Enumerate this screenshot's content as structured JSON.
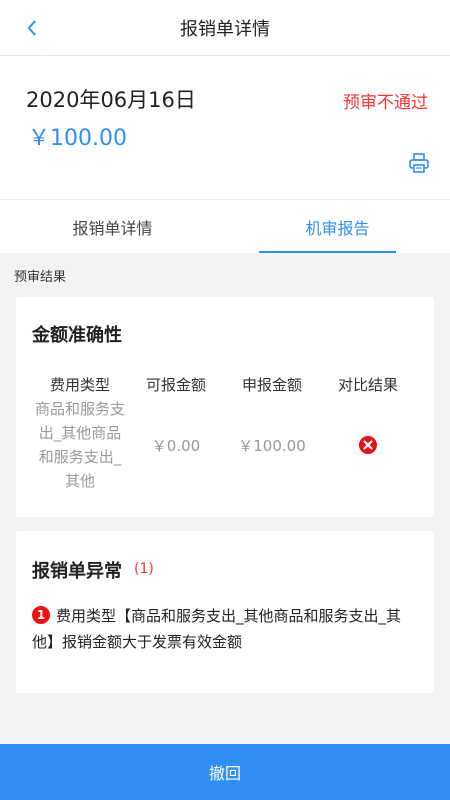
{
  "header": {
    "title": "报销单详情",
    "back_icon": "chevron-left-icon"
  },
  "summary": {
    "date": "2020年06月16日",
    "amount": "￥100.00",
    "status": "预审不通过",
    "print_icon": "printer-icon"
  },
  "tabs": [
    {
      "label": "报销单详情",
      "active": false
    },
    {
      "label": "机审报告",
      "active": true
    }
  ],
  "section_label": "预审结果",
  "accuracy": {
    "title": "金额准确性",
    "columns": [
      "费用类型",
      "可报金额",
      "申报金额",
      "对比结果"
    ],
    "rows": [
      {
        "type": "商品和服务支出_其他商品和服务支出_其他",
        "allowable": "￥0.00",
        "declared": "￥100.00",
        "result_icon": "error-x-icon"
      }
    ]
  },
  "abnormal": {
    "title": "报销单异常",
    "count": "(1)",
    "items": [
      {
        "index": "1",
        "text": "费用类型【商品和服务支出_其他商品和服务支出_其他】报销金额大于发票有效金额"
      }
    ]
  },
  "footer": {
    "withdraw_label": "撤回"
  },
  "colors": {
    "accent": "#2f8ff2",
    "danger": "#ff3333"
  }
}
